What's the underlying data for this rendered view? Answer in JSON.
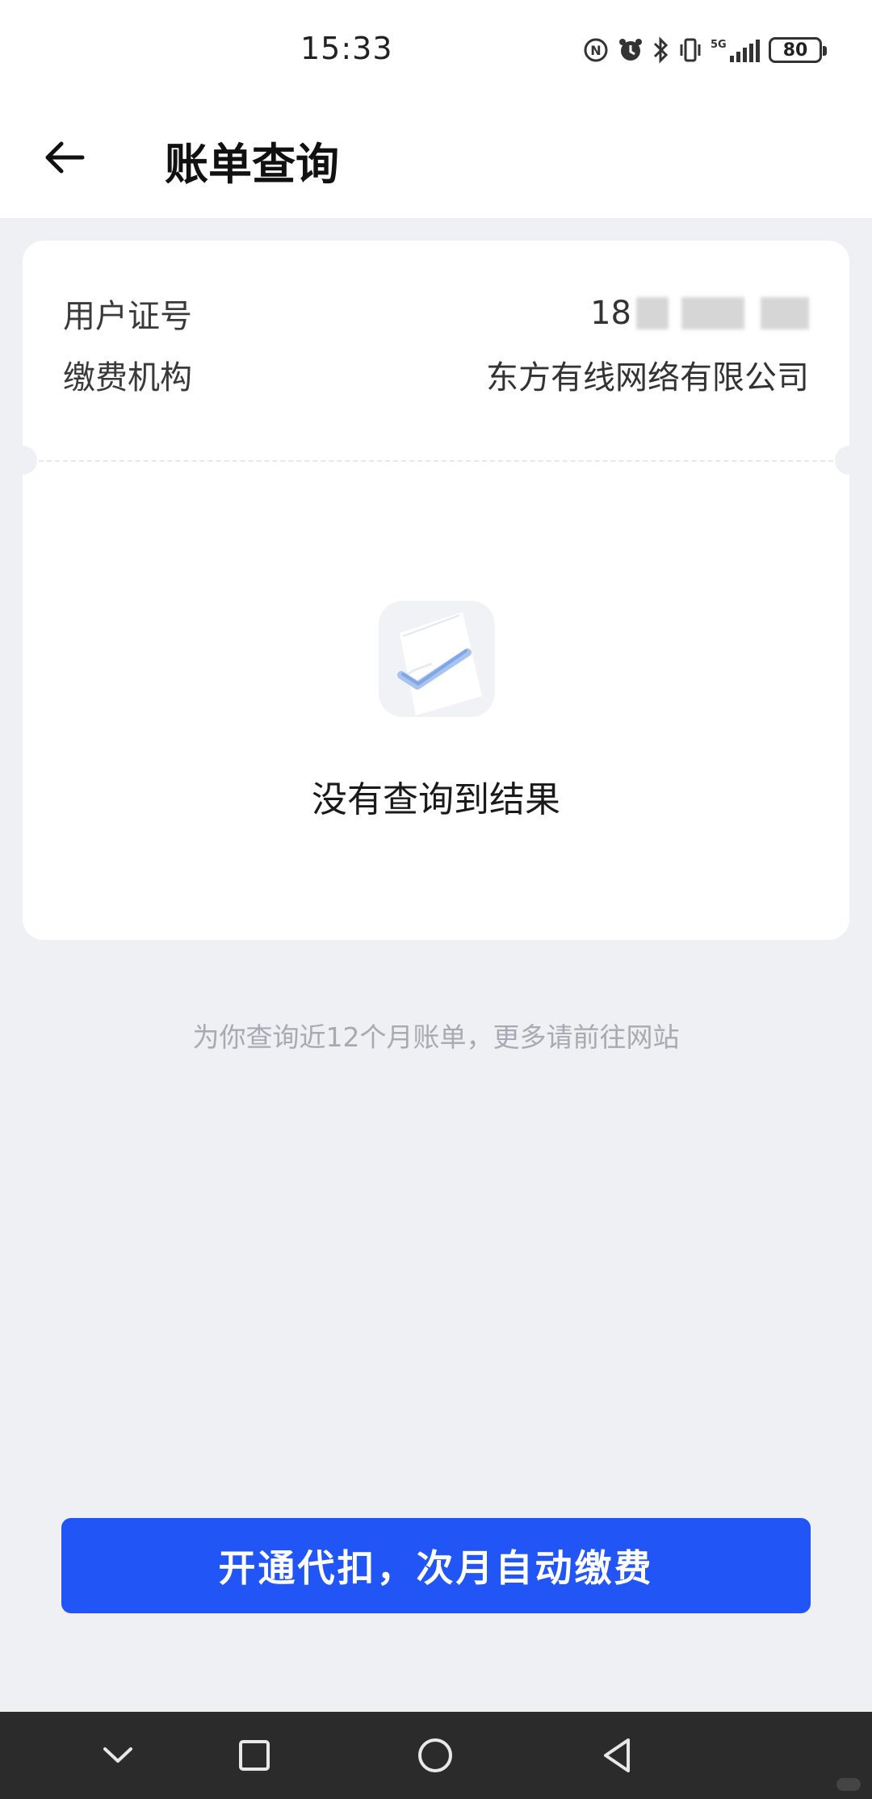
{
  "status_bar": {
    "time": "15:33",
    "network": "5G",
    "battery": "80",
    "icons": [
      "nfc-icon",
      "alarm-icon",
      "bluetooth-icon",
      "vibrate-icon",
      "signal-icon",
      "battery-icon"
    ]
  },
  "header": {
    "back_icon": "arrow-left-icon",
    "title": "账单查询"
  },
  "card": {
    "rows": [
      {
        "label": "用户证号",
        "value": "18"
      },
      {
        "label": "缴费机构",
        "value": "东方有线网络有限公司"
      }
    ],
    "empty_icon": "checked-document-icon",
    "empty_text": "没有查询到结果"
  },
  "hint": "为你查询近12个月账单，更多请前往网站",
  "primary_button": "开通代扣，次月自动缴费",
  "nav_bar": {
    "icons": [
      "chevron-down-icon",
      "square-icon",
      "circle-icon",
      "triangle-back-icon"
    ]
  },
  "colors": {
    "accent": "#2155f6",
    "background": "#eef0f4",
    "hint": "#a7aab1"
  }
}
